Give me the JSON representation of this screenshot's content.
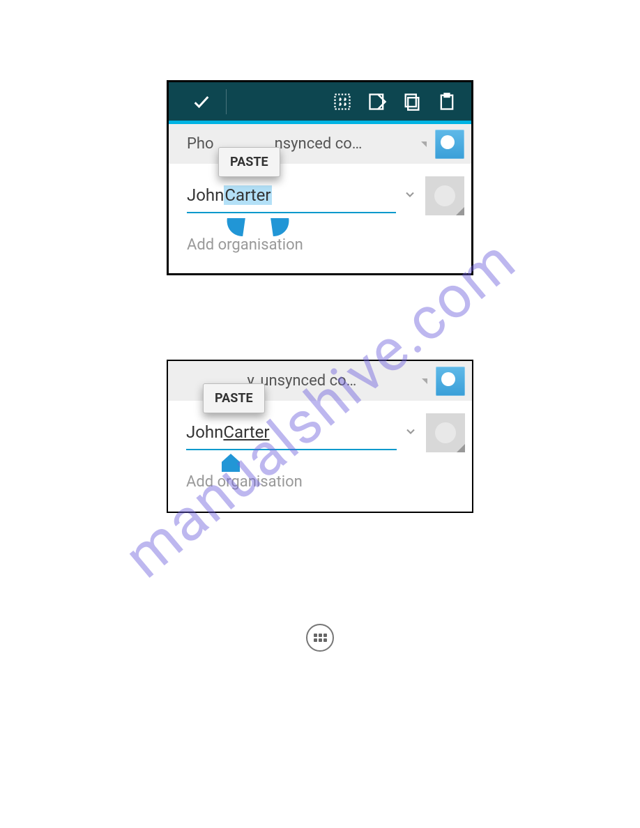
{
  "watermark": "manualshive.com",
  "screenshot1": {
    "paste_label": "PASTE",
    "account_text_prefix": "Pho",
    "account_text_suffix": "nsynced co…",
    "name_first": "John ",
    "name_selected": "Carter",
    "org_placeholder": "Add organisation"
  },
  "screenshot2": {
    "paste_label": "PASTE",
    "account_text_suffix": "y, unsynced co…",
    "name_first": "John ",
    "name_last": "Carter",
    "org_placeholder": "Add organisation"
  }
}
